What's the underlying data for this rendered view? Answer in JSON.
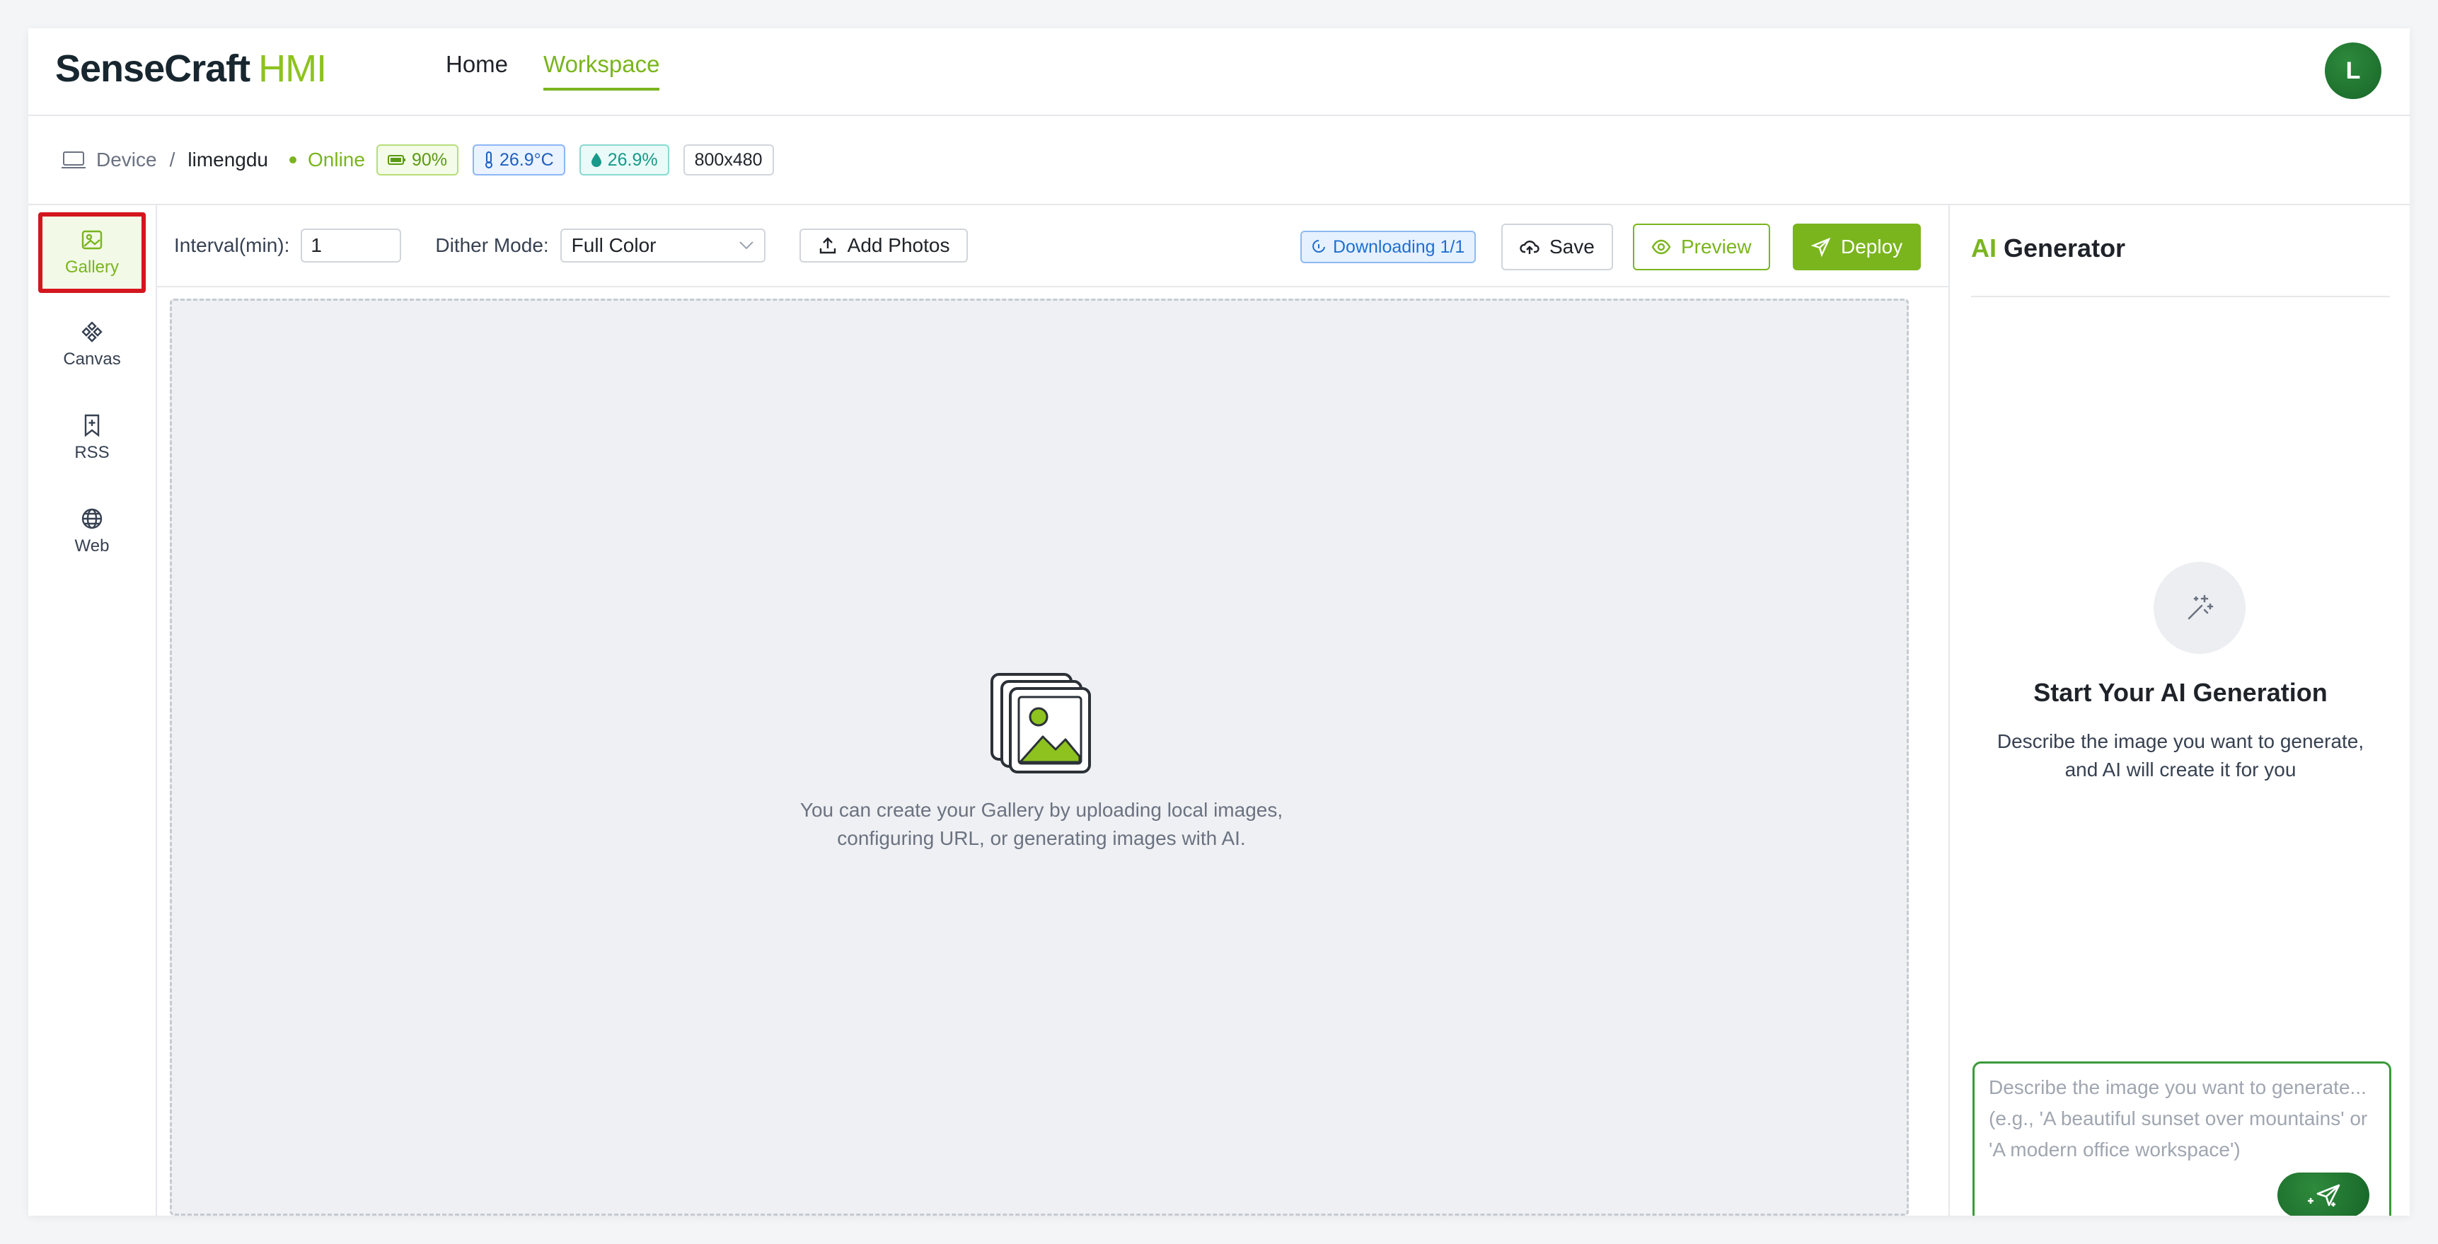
{
  "header": {
    "logo_main": "SenseCraft",
    "logo_accent": "HMI",
    "nav": [
      {
        "label": "Home"
      },
      {
        "label": "Workspace"
      }
    ],
    "avatar_initial": "L"
  },
  "device_bar": {
    "device_label": "Device",
    "separator": "/",
    "device_name": "limengdu",
    "status": "Online",
    "battery": "90%",
    "temperature": "26.9°C",
    "humidity": "26.9%",
    "resolution": "800x480"
  },
  "sidebar": {
    "items": [
      {
        "label": "Gallery",
        "icon": "image-icon",
        "active": true
      },
      {
        "label": "Canvas",
        "icon": "canvas-icon"
      },
      {
        "label": "RSS",
        "icon": "bookmark-plus-icon"
      },
      {
        "label": "Web",
        "icon": "globe-icon"
      }
    ]
  },
  "toolbar": {
    "interval_label": "Interval(min):",
    "interval_value": "1",
    "dither_label": "Dither Mode:",
    "dither_value": "Full Color",
    "add_photos_label": "Add Photos",
    "download_status": "Downloading 1/1",
    "save_label": "Save",
    "preview_label": "Preview",
    "deploy_label": "Deploy"
  },
  "gallery": {
    "empty_line1": "You can create your Gallery by uploading local images,",
    "empty_line2": "configuring URL, or generating images with AI."
  },
  "ai_panel": {
    "title_accent": "AI",
    "title_rest": "Generator",
    "start_title": "Start Your AI Generation",
    "start_desc_line1": "Describe the image you want to generate,",
    "start_desc_line2": "and AI will create it for you",
    "prompt_placeholder": "Describe the image you want to generate... (e.g., 'A beautiful sunset over mountains' or 'A modern office workspace')"
  },
  "colors": {
    "brand_green": "#7ab51d",
    "deploy_green": "#7ab51d",
    "ai_button_green": "#1f7a30",
    "highlight_red": "#d4161f"
  }
}
